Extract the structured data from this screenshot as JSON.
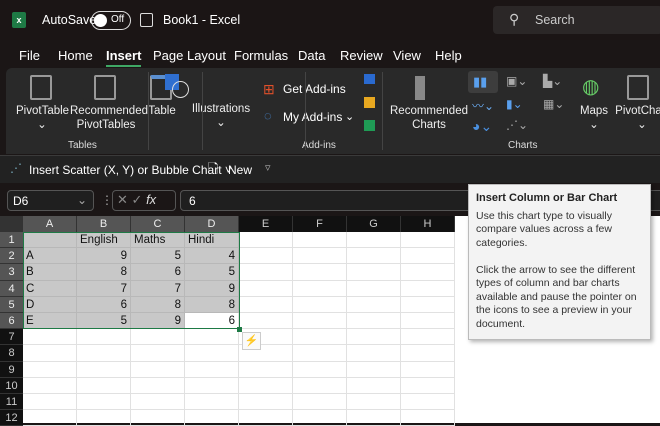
{
  "titlebar": {
    "autosave": "AutoSave",
    "toggle": "Off",
    "title": "Book1  -  Excel",
    "search": "Search"
  },
  "menu": [
    "File",
    "Home",
    "Insert",
    "Page Layout",
    "Formulas",
    "Data",
    "Review",
    "View",
    "Help"
  ],
  "ribbon": {
    "pivottable": "PivotTable",
    "recommended_pivot": "Recommended PivotTables",
    "table": "Table",
    "illustrations": "Illustrations",
    "get_addins": "Get Add-ins",
    "my_addins": "My Add-ins",
    "recommended_charts": "Recommended Charts",
    "maps": "Maps",
    "pivotchart": "PivotChart",
    "groups": {
      "tables": "Tables",
      "addins": "Add-ins",
      "charts": "Charts"
    }
  },
  "row2": {
    "scatter": "Insert Scatter (X, Y) or Bubble Chart",
    "new": "New"
  },
  "formula": {
    "namebox": "D6",
    "fx": "fx",
    "value": "6"
  },
  "columns": [
    "A",
    "B",
    "C",
    "D",
    "E",
    "F",
    "G",
    "H"
  ],
  "rows": [
    "1",
    "2",
    "3",
    "4",
    "5",
    "6",
    "7",
    "8",
    "9",
    "10",
    "11",
    "12"
  ],
  "table": {
    "header": [
      "",
      "English",
      "Maths",
      "Hindi"
    ],
    "data": [
      [
        "A",
        9,
        5,
        4
      ],
      [
        "B",
        8,
        6,
        5
      ],
      [
        "C",
        7,
        7,
        9
      ],
      [
        "D",
        6,
        8,
        8
      ],
      [
        "E",
        5,
        9,
        6
      ]
    ]
  },
  "tooltip": {
    "title": "Insert Column or Bar Chart",
    "p1": "Use this chart type to visually compare values across a few categories.",
    "p2": "Click the arrow to see the different types of column and bar charts available and pause the pointer on the icons to see a preview in your document."
  }
}
